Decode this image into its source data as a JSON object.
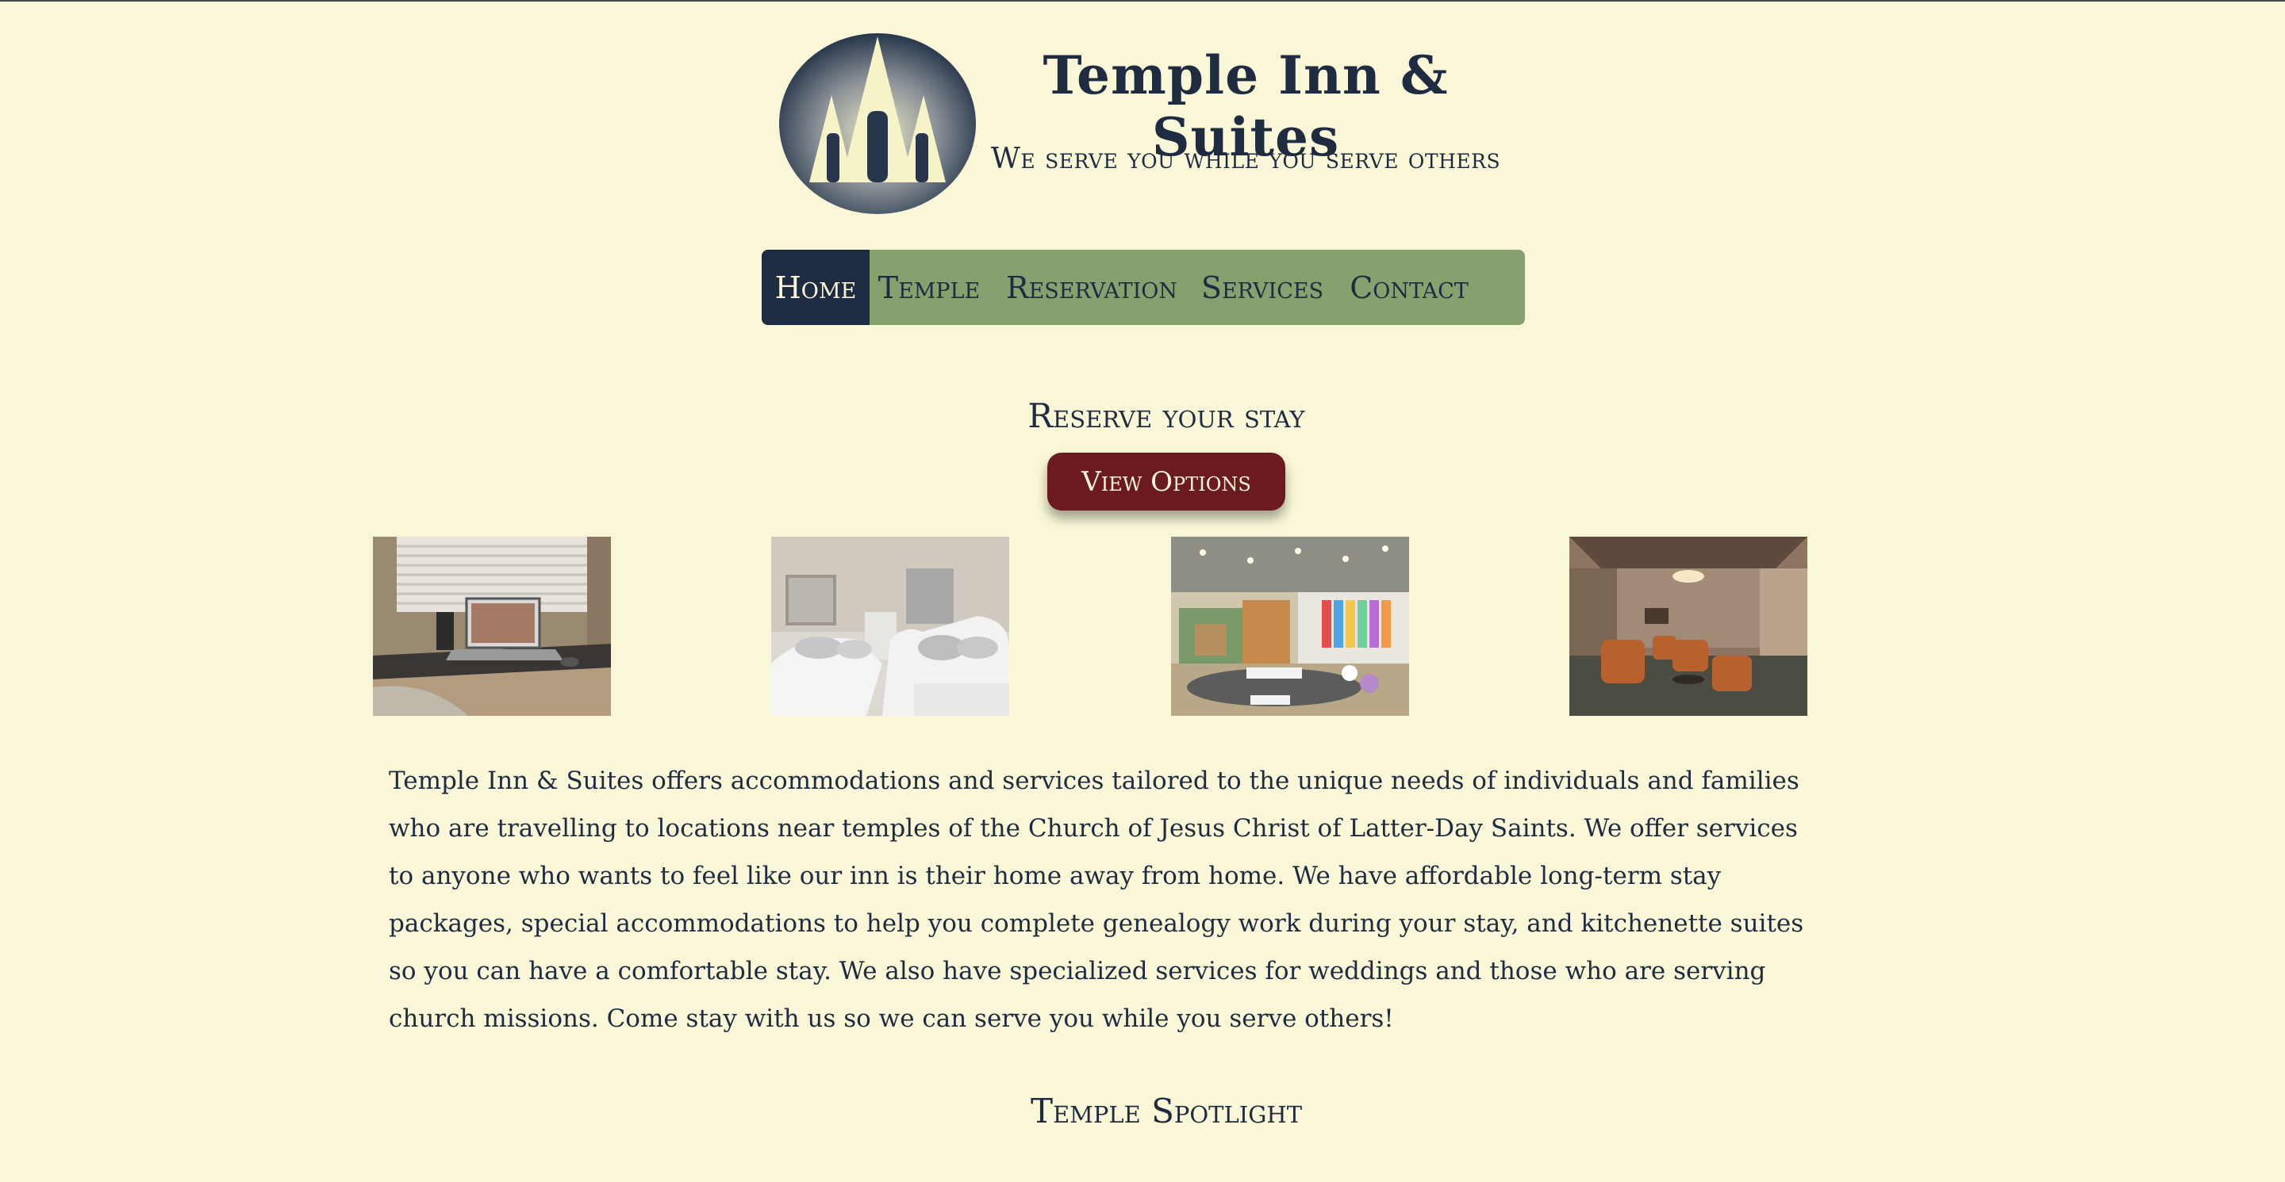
{
  "header": {
    "title": "Temple Inn & Suites",
    "tagline": "We serve you while you serve others"
  },
  "nav": {
    "items": [
      {
        "label": "Home",
        "active": true
      },
      {
        "label": "Temple",
        "active": false
      },
      {
        "label": "Reservation",
        "active": false
      },
      {
        "label": "Services",
        "active": false
      },
      {
        "label": "Contact",
        "active": false
      }
    ]
  },
  "reserve": {
    "heading": "Reserve your stay",
    "button_label": "View Options"
  },
  "gallery": {
    "images": [
      "desk-laptop-photo",
      "twin-beds-photo",
      "kids-playroom-photo",
      "lounge-armchairs-photo"
    ]
  },
  "description": "Temple Inn & Suites offers accommodations and services tailored to the unique needs of individuals and families who are travelling to locations near temples of the Church of Jesus Christ of Latter-Day Saints. We offer services to anyone who wants to feel like our inn is their home away from home. We have affordable long-term stay packages, special accommodations to help you complete genealogy work during your stay, and kitchenette suites so you can have a comfortable stay. We also have specialized services for weddings and those who are serving church missions. Come stay with us so we can serve you while you serve others!",
  "spotlight": {
    "heading": "Temple Spotlight"
  },
  "colors": {
    "background": "#f9f7d8",
    "navy": "#1f2b40",
    "nav_green": "#87a06d",
    "button_maroon": "#6b1a20"
  }
}
